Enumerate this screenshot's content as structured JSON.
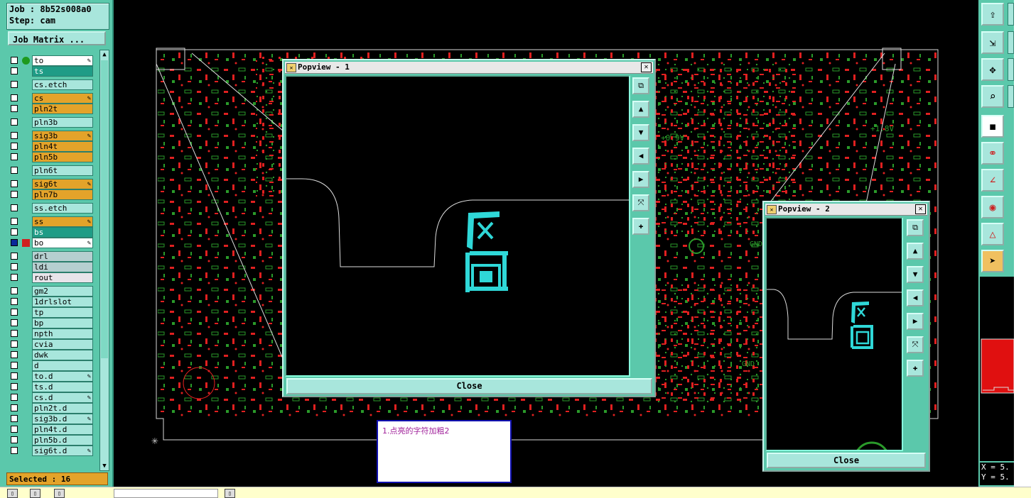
{
  "job": {
    "job_label": "Job : 8b52s008a0",
    "step_label": "Step: cam"
  },
  "job_matrix_button": "Job Matrix ...",
  "layers": [
    {
      "name": "to",
      "style": "w",
      "mark": true,
      "pen": true
    },
    {
      "name": "ts",
      "style": "t"
    },
    {
      "name": "cs.etch",
      "style": "c"
    },
    {
      "name": "cs",
      "style": "o",
      "pen": true
    },
    {
      "name": "pln2t",
      "style": "o"
    },
    {
      "name": "pln3b",
      "style": "c"
    },
    {
      "name": "sig3b",
      "style": "o",
      "pen": true
    },
    {
      "name": "pln4t",
      "style": "o"
    },
    {
      "name": "pln5b",
      "style": "o"
    },
    {
      "name": "pln6t",
      "style": "c"
    },
    {
      "name": "sig6t",
      "style": "o",
      "pen": true
    },
    {
      "name": "pln7b",
      "style": "o"
    },
    {
      "name": "ss.etch",
      "style": "c"
    },
    {
      "name": "ss",
      "style": "o",
      "pen": true
    },
    {
      "name": "bs",
      "style": "t"
    },
    {
      "name": "bo",
      "style": "w",
      "pen": true,
      "active": true
    },
    {
      "name": "drl",
      "style": "g"
    },
    {
      "name": "ldi",
      "style": "g"
    },
    {
      "name": "rout",
      "style": "p"
    },
    {
      "name": "gm2",
      "style": "c"
    },
    {
      "name": "1drlslot",
      "style": "c"
    },
    {
      "name": "tp",
      "style": "c"
    },
    {
      "name": "bp",
      "style": "c"
    },
    {
      "name": "npth",
      "style": "c"
    },
    {
      "name": "cvia",
      "style": "c"
    },
    {
      "name": "dwk",
      "style": "c"
    },
    {
      "name": "d",
      "style": "c"
    },
    {
      "name": "to.d",
      "style": "c",
      "pen": true
    },
    {
      "name": "ts.d",
      "style": "c"
    },
    {
      "name": "cs.d",
      "style": "c",
      "pen": true
    },
    {
      "name": "pln2t.d",
      "style": "c"
    },
    {
      "name": "sig3b.d",
      "style": "c",
      "pen": true
    },
    {
      "name": "pln4t.d",
      "style": "c"
    },
    {
      "name": "pln5b.d",
      "style": "c"
    },
    {
      "name": "sig6t.d",
      "style": "c",
      "pen": true
    }
  ],
  "selected_label": "Selected : 16",
  "popview1": {
    "title": "Popview - 1",
    "close_label": "Close"
  },
  "popview2": {
    "title": "Popview - 2",
    "close_label": "Close"
  },
  "note_text": "1.点亮的字符加粗2",
  "board_labels": {
    "v09": "+0.9V",
    "v18": "+1.8V",
    "gnd1": "GND",
    "gnd2": "GND"
  },
  "coordinate_readout": {
    "x": "X = 5.",
    "y": "Y = 5."
  },
  "colors": {
    "panel": "#5bc8ab",
    "layer_orange": "#e3a32a",
    "layer_teal": "#1f9c86",
    "highlight_cyan": "#2fd8d8",
    "board_red": "#e02020",
    "board_green": "#2a9a2a"
  }
}
